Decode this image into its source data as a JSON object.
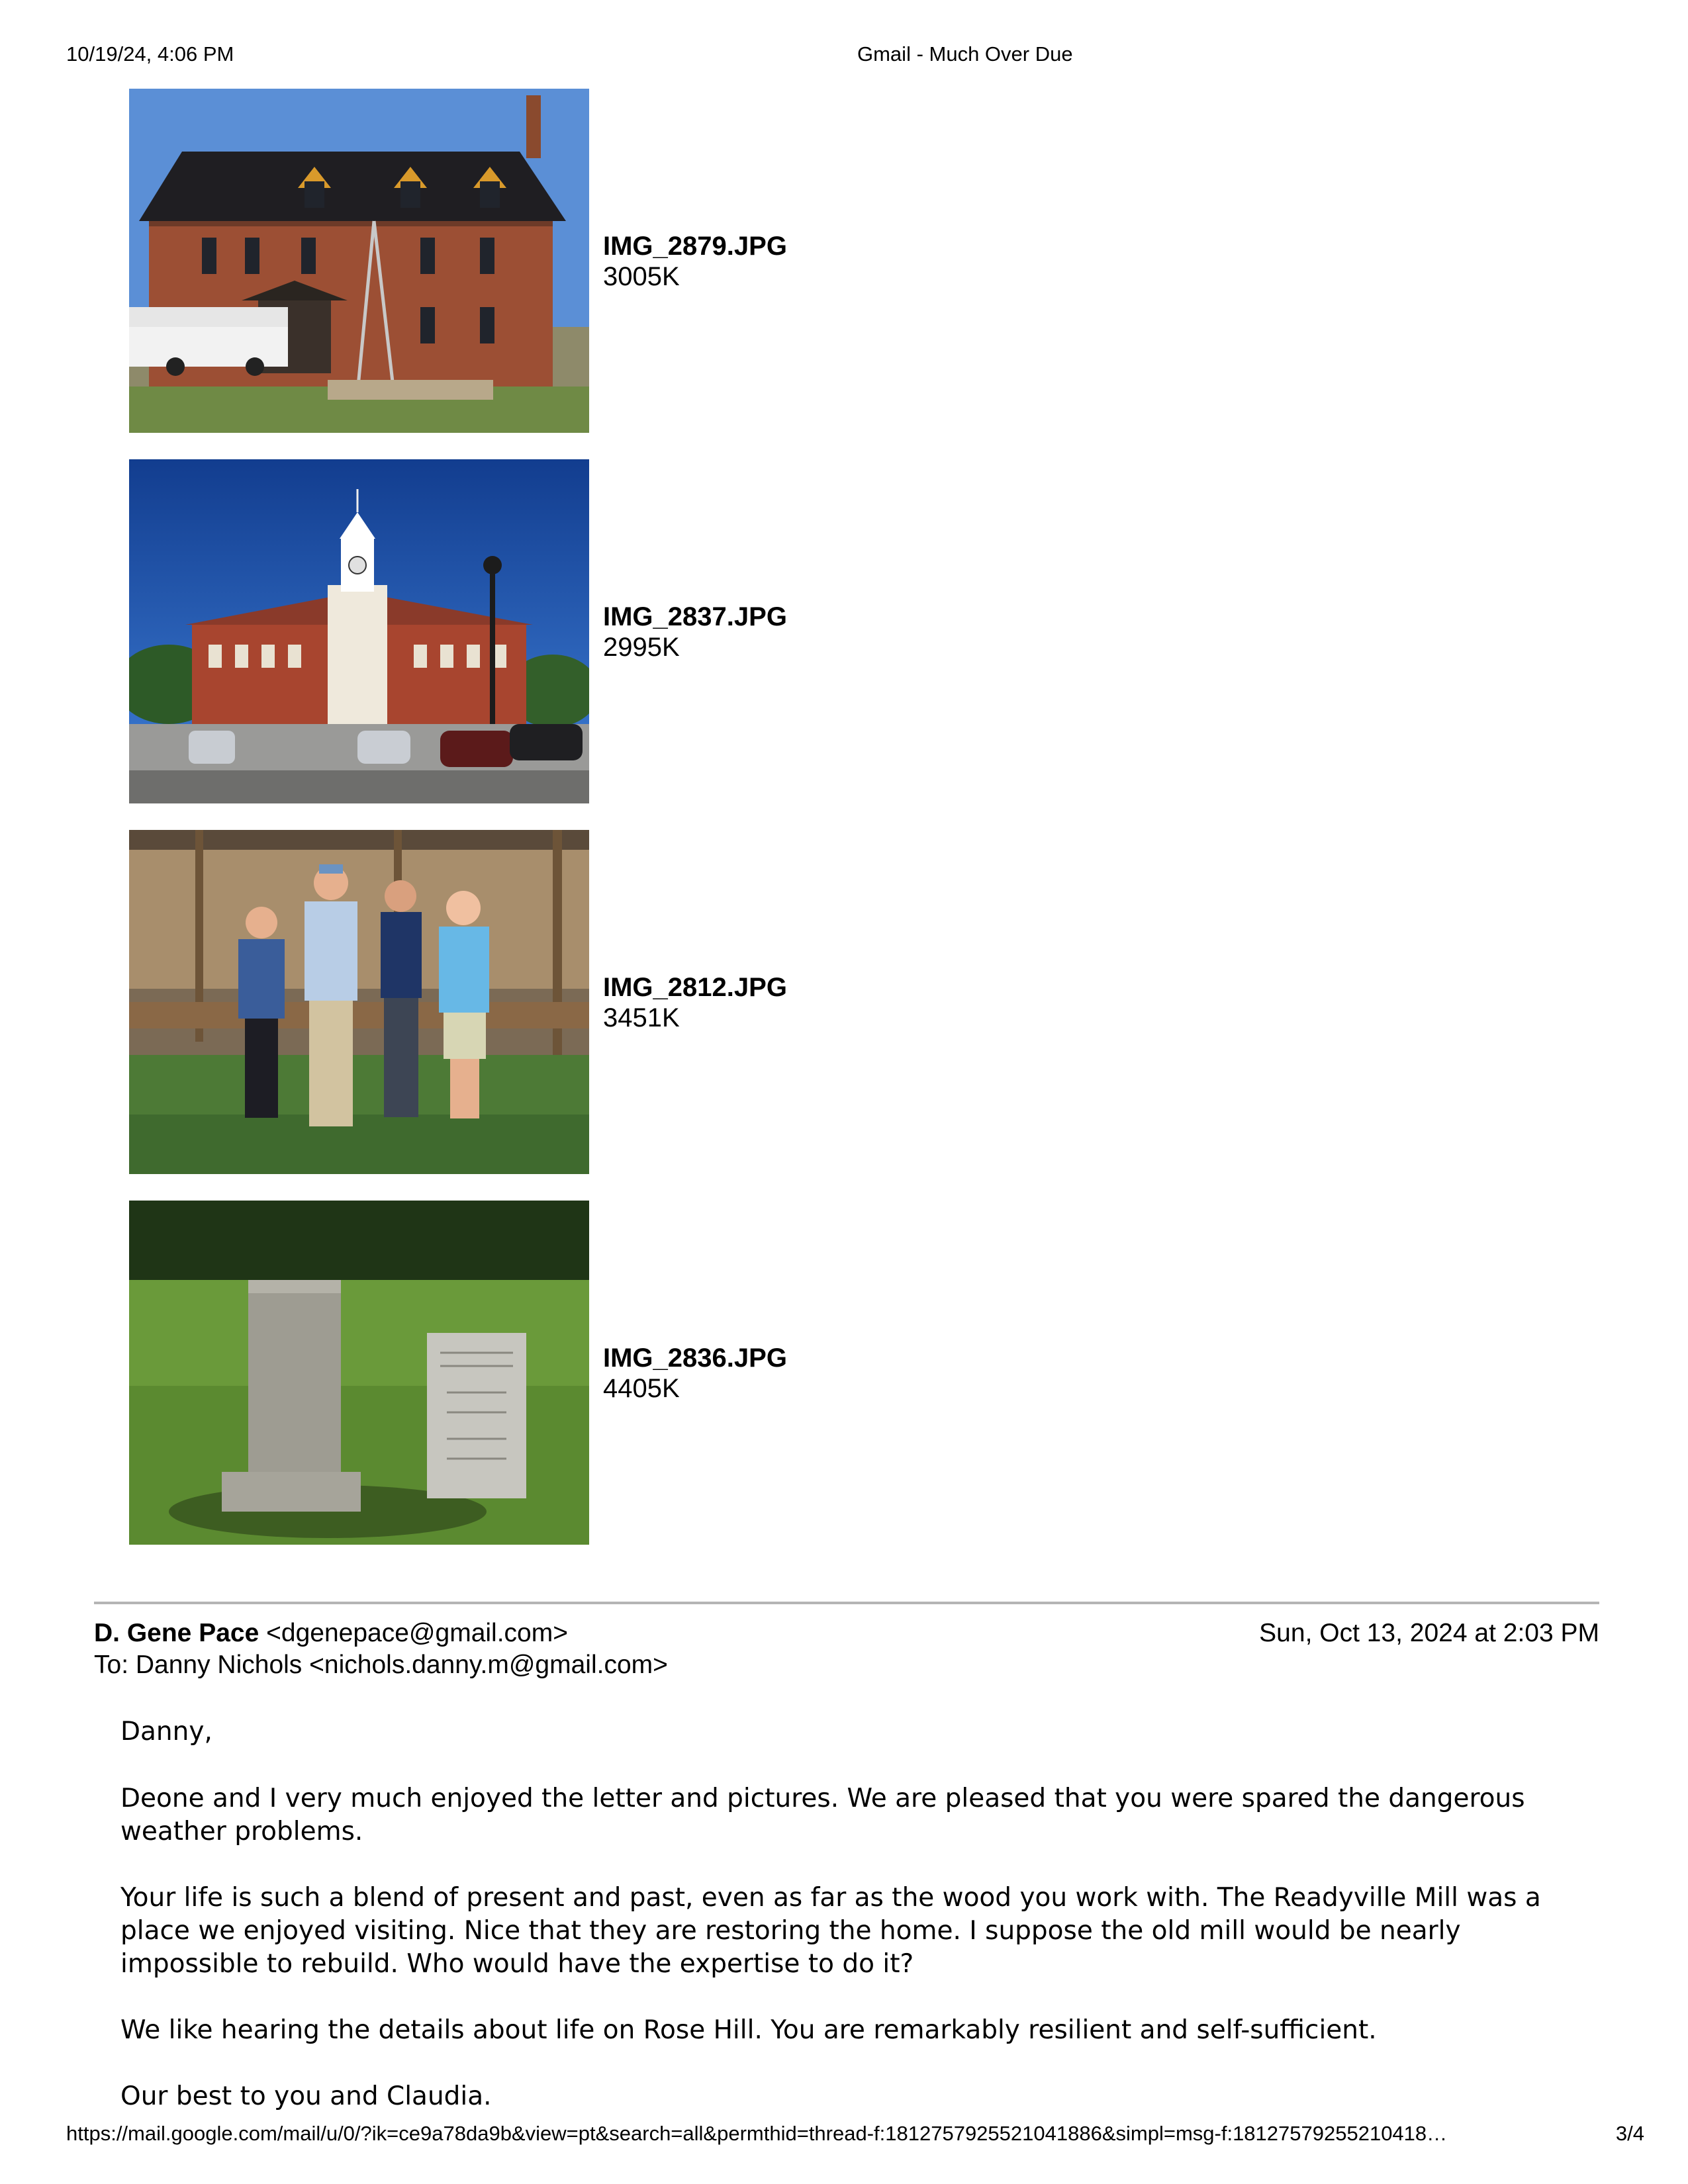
{
  "print_header": {
    "date": "10/19/24, 4:06 PM",
    "title": "Gmail - Much Over Due"
  },
  "attachments": [
    {
      "filename": "IMG_2879.JPG",
      "size": "3005K"
    },
    {
      "filename": "IMG_2837.JPG",
      "size": "2995K"
    },
    {
      "filename": "IMG_2812.JPG",
      "size": "3451K"
    },
    {
      "filename": "IMG_2836.JPG",
      "size": "4405K"
    }
  ],
  "message": {
    "sender_name": "D. Gene Pace",
    "sender_email": "<dgenepace@gmail.com>",
    "date": "Sun, Oct 13, 2024 at 2:03 PM",
    "to": "To: Danny Nichols <nichols.danny.m@gmail.com>",
    "body": [
      "Danny,",
      "Deone and I very much enjoyed the letter and pictures. We are pleased that you were spared the dangerous weather problems.",
      "Your life is such a blend of present and past, even as far as the wood you work with. The Readyville Mill was a place we enjoyed visiting. Nice that they are restoring the home. I suppose the old mill would be nearly impossible to rebuild. Who would have the expertise to do it?",
      "We like hearing the details about life on Rose Hill. You are remarkably resilient and self-sufficient.",
      "Our best to you and Claudia."
    ]
  },
  "print_footer": {
    "url": "https://mail.google.com/mail/u/0/?ik=ce9a78da9b&view=pt&search=all&permthid=thread-f:1812757925521041886&simpl=msg-f:18127579255210418…",
    "page": "3/4"
  }
}
